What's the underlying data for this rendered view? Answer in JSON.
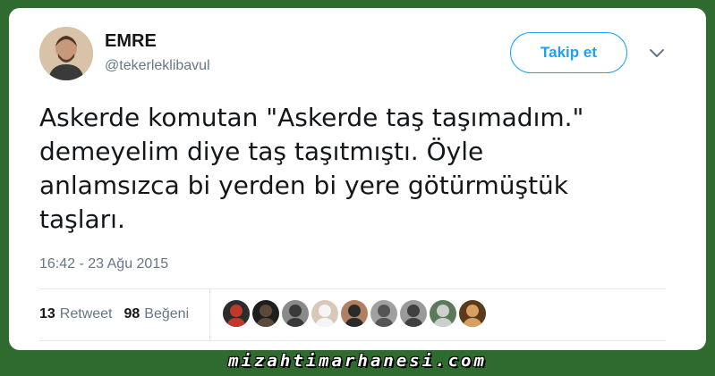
{
  "user": {
    "name": "EMRE",
    "handle": "@tekerleklibavul"
  },
  "follow_button": {
    "label": "Takip et"
  },
  "tweet": {
    "text_lines": [
      "Askerde komutan \"Askerde taş taşımadım.\"",
      "demeyelim diye taş taşıtmıştı. Öyle",
      "anlamsızca bi yerden bi yere götürmüştük",
      "taşları."
    ],
    "timestamp": "16:42 - 23 Ağu 2015"
  },
  "stats": {
    "retweets_count": "13",
    "retweets_label": "Retweet",
    "likes_count": "98",
    "likes_label": "Beğeni"
  },
  "liker_avatars": [
    {
      "name": "liker-avatar-1",
      "colors": [
        "#c0392b",
        "#2c2c2c"
      ]
    },
    {
      "name": "liker-avatar-2",
      "colors": [
        "#5a4a3a",
        "#1e1e1e"
      ]
    },
    {
      "name": "liker-avatar-3",
      "colors": [
        "#3a3a3a",
        "#8a8a8a"
      ]
    },
    {
      "name": "liker-avatar-4",
      "colors": [
        "#f5f5f5",
        "#d8c8b8"
      ]
    },
    {
      "name": "liker-avatar-5",
      "colors": [
        "#2a2a2a",
        "#b08060"
      ]
    },
    {
      "name": "liker-avatar-6",
      "colors": [
        "#555555",
        "#a0a0a0"
      ]
    },
    {
      "name": "liker-avatar-7",
      "colors": [
        "#404040",
        "#9a9a9a"
      ]
    },
    {
      "name": "liker-avatar-8",
      "colors": [
        "#cfcfcf",
        "#5a7a5a"
      ]
    },
    {
      "name": "liker-avatar-9",
      "colors": [
        "#d8a060",
        "#5a3a1a"
      ]
    }
  ],
  "watermark": "mizahtimarhanesi.com",
  "colors": {
    "accent": "#1da1f2",
    "text": "#14171a",
    "muted": "#657786",
    "background": "#2f6b2f"
  }
}
